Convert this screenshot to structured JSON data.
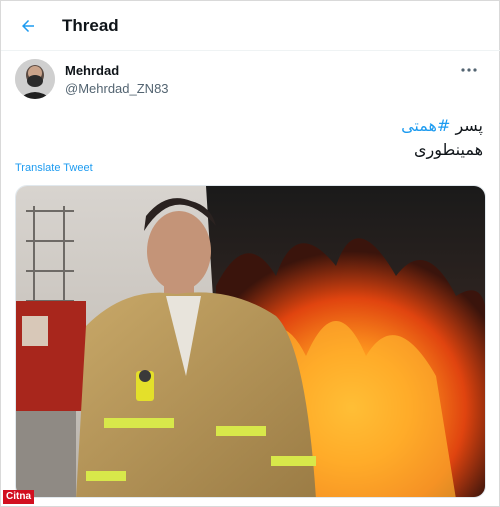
{
  "header": {
    "title": "Thread",
    "back_icon": "arrow-left-icon"
  },
  "tweet": {
    "author_name": "Mehrdad",
    "author_handle": "@Mehrdad_ZN83",
    "more_icon": "more-horizontal-icon",
    "text_line1_pre": "پسر ",
    "hashtag": "#همتی",
    "text_line2": "همینطوری",
    "translate_label": "Translate Tweet",
    "media_description": "firefighter-in-front-of-fire-photo"
  },
  "watermark": {
    "label": "Citna"
  },
  "colors": {
    "accent": "#1d9bf0",
    "text": "#0f1419",
    "secondary": "#536471"
  }
}
